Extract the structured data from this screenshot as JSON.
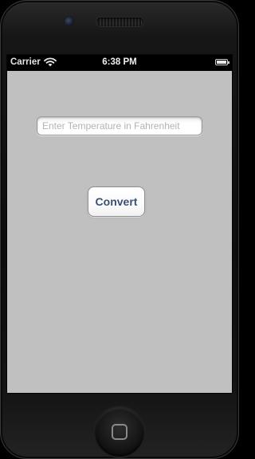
{
  "status_bar": {
    "carrier": "Carrier",
    "time": "6:38 PM",
    "wifi_icon": "wifi-icon",
    "battery_icon": "battery-icon",
    "battery_level": 1.0
  },
  "form": {
    "temperature_placeholder": "Enter Temperature in Fahrenheit",
    "temperature_value": "",
    "convert_label": "Convert"
  },
  "colors": {
    "background": "#c0c0c0",
    "button_text": "#3a4f73"
  }
}
